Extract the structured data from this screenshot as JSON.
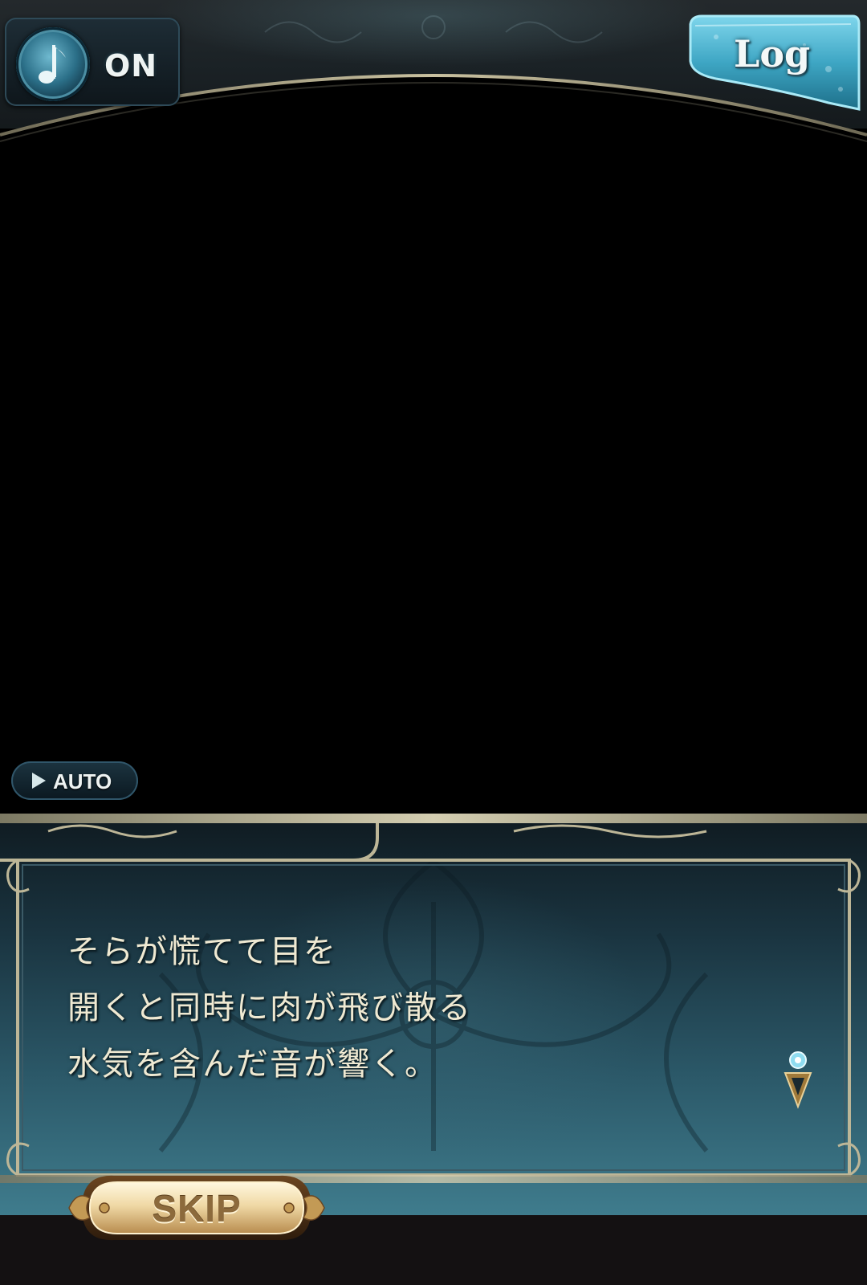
{
  "header": {
    "sound_toggle": {
      "icon": "music-note-icon",
      "state_label": "ON"
    },
    "log_button": {
      "label": "Log"
    }
  },
  "controls": {
    "auto_button": {
      "icon": "play-icon",
      "label": "AUTO"
    },
    "skip_button": {
      "label": "SKIP"
    }
  },
  "dialogue": {
    "lines": [
      "そらが慌てて目を",
      "開くと同時に肉が飛び散る",
      "水気を含んだ音が響く。"
    ],
    "advance_indicator_icon": "advance-arrow-icon"
  },
  "colors": {
    "dialogue_text": "#efe9d2",
    "panel_teal": "#3f7c8d",
    "frame_gold": "#cdc8a7",
    "log_blue": "#5fc2dc",
    "skip_gold": "#e8c98a"
  }
}
